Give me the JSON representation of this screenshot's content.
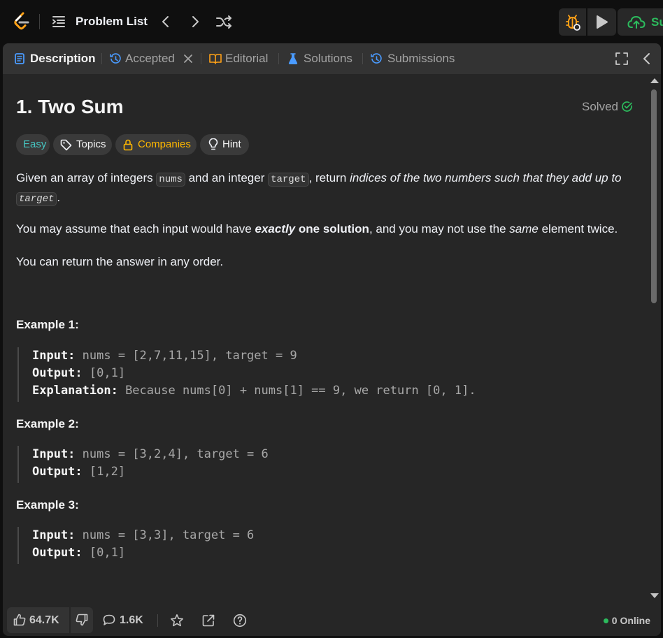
{
  "nav": {
    "problem_list_label": "Problem List",
    "submit_label": "Submit",
    "colors": {
      "brand": "#ffa116",
      "submit": "#2cbb5d",
      "debug": "#ffa116"
    }
  },
  "tabs": [
    {
      "label": "Description",
      "icon": "description-icon",
      "active": true
    },
    {
      "label": "Accepted",
      "icon": "history-icon",
      "closable": true
    },
    {
      "label": "Editorial",
      "icon": "book-icon"
    },
    {
      "label": "Solutions",
      "icon": "flask-icon"
    },
    {
      "label": "Submissions",
      "icon": "history-icon"
    }
  ],
  "problem": {
    "title": "1. Two Sum",
    "status": "Solved",
    "tags": {
      "difficulty": "Easy",
      "topics": "Topics",
      "companies": "Companies",
      "hint": "Hint"
    },
    "description": {
      "p1": {
        "a": "Given an array of integers ",
        "code1": "nums",
        "b": " and an integer ",
        "code2": "target",
        "c": ", return ",
        "em": "indices of the two numbers such that they add up to",
        "code3": "target",
        "d": "."
      },
      "p2": {
        "a": "You may assume that each input would have ",
        "em_strong": "exactly",
        "strong": " one solution",
        "b": ", and you may not use the ",
        "em": "same",
        "c": " element twice."
      },
      "p3": "You can return the answer in any order."
    },
    "examples": [
      {
        "heading": "Example 1:",
        "input_label": "Input:",
        "input": " nums = [2,7,11,15], target = 9",
        "output_label": "Output:",
        "output": " [0,1]",
        "explanation_label": "Explanation:",
        "explanation": " Because nums[0] + nums[1] == 9, we return [0, 1]."
      },
      {
        "heading": "Example 2:",
        "input_label": "Input:",
        "input": " nums = [3,2,4], target = 6",
        "output_label": "Output:",
        "output": " [1,2]"
      },
      {
        "heading": "Example 3:",
        "input_label": "Input:",
        "input": " nums = [3,3], target = 6",
        "output_label": "Output:",
        "output": " [0,1]"
      }
    ]
  },
  "footer": {
    "likes": "64.7K",
    "comments": "1.6K",
    "online": "0 Online"
  }
}
